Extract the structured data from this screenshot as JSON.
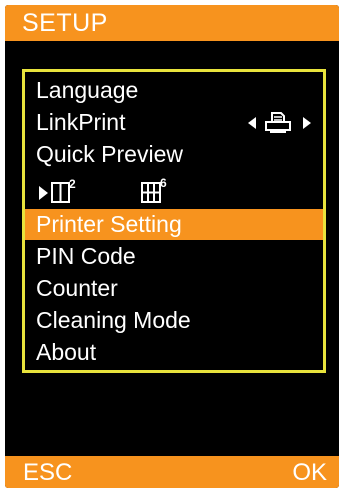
{
  "header": {
    "title": "SETUP"
  },
  "menu": {
    "items": [
      {
        "label": "Language"
      },
      {
        "label": "LinkPrint",
        "value_icon": "printer-icon"
      },
      {
        "label": "Quick Preview"
      },
      {
        "label": "Printer Setting",
        "selected": true
      },
      {
        "label": "PIN Code"
      },
      {
        "label": "Counter"
      },
      {
        "label": "Cleaning Mode"
      },
      {
        "label": "About"
      }
    ],
    "quick_preview_options": [
      {
        "icon": "layout-2-up-icon",
        "badge": "2",
        "selected": true
      },
      {
        "icon": "layout-6-up-icon",
        "badge": "6",
        "selected": false
      }
    ]
  },
  "footer": {
    "left_label": "ESC",
    "right_label": "OK"
  },
  "colors": {
    "accent": "#f7931e",
    "frame": "#e8e33c",
    "background": "#000000",
    "text": "#ffffff"
  }
}
